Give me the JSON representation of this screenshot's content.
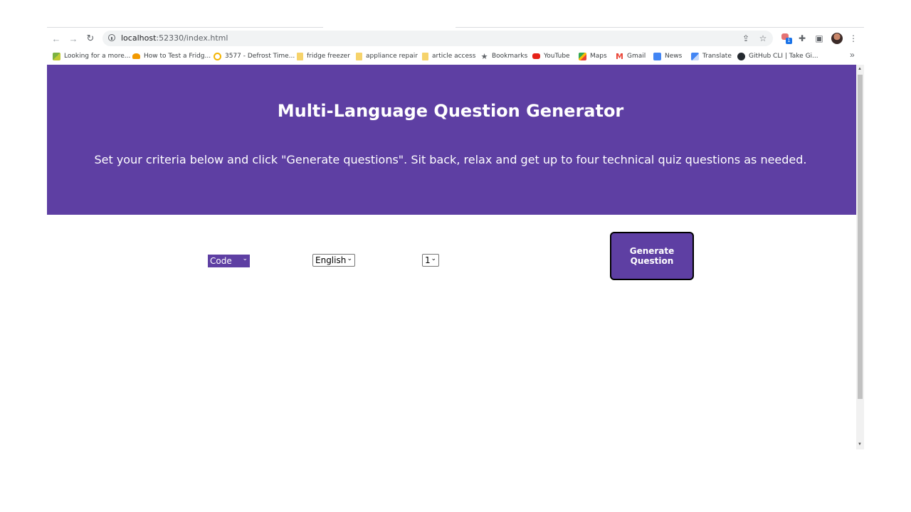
{
  "browser": {
    "url_host": "localhost",
    "url_rest": ":52330/index.html",
    "extension_badge": "1",
    "bookmarks": [
      {
        "label": "Looking for a more...",
        "icon": "green-leaf-icon"
      },
      {
        "label": "How to Test a Fridg...",
        "icon": "orange-hat-icon"
      },
      {
        "label": "3577 - Defrost Time...",
        "icon": "ring-icon"
      },
      {
        "label": "fridge freezer",
        "icon": "folder-icon"
      },
      {
        "label": "appliance repair",
        "icon": "folder-icon"
      },
      {
        "label": "article access",
        "icon": "folder-icon"
      },
      {
        "label": "Bookmarks",
        "icon": "star-icon"
      },
      {
        "label": "YouTube",
        "icon": "youtube-icon"
      },
      {
        "label": "Maps",
        "icon": "maps-icon"
      },
      {
        "label": "Gmail",
        "icon": "gmail-icon"
      },
      {
        "label": "News",
        "icon": "news-icon"
      },
      {
        "label": "Translate",
        "icon": "translate-icon"
      },
      {
        "label": "GitHub CLI | Take Gi...",
        "icon": "github-icon"
      }
    ],
    "more_glyph": "»"
  },
  "page": {
    "title": "Multi-Language Question Generator",
    "subtitle": "Set your criteria below and click \"Generate questions\". Sit back, relax and get up to four technical quiz questions as needed.",
    "category_select": "Code",
    "language_select": "English",
    "count_select": "1",
    "generate_button": "Generate Question",
    "accent_color": "#5e3fa3"
  }
}
